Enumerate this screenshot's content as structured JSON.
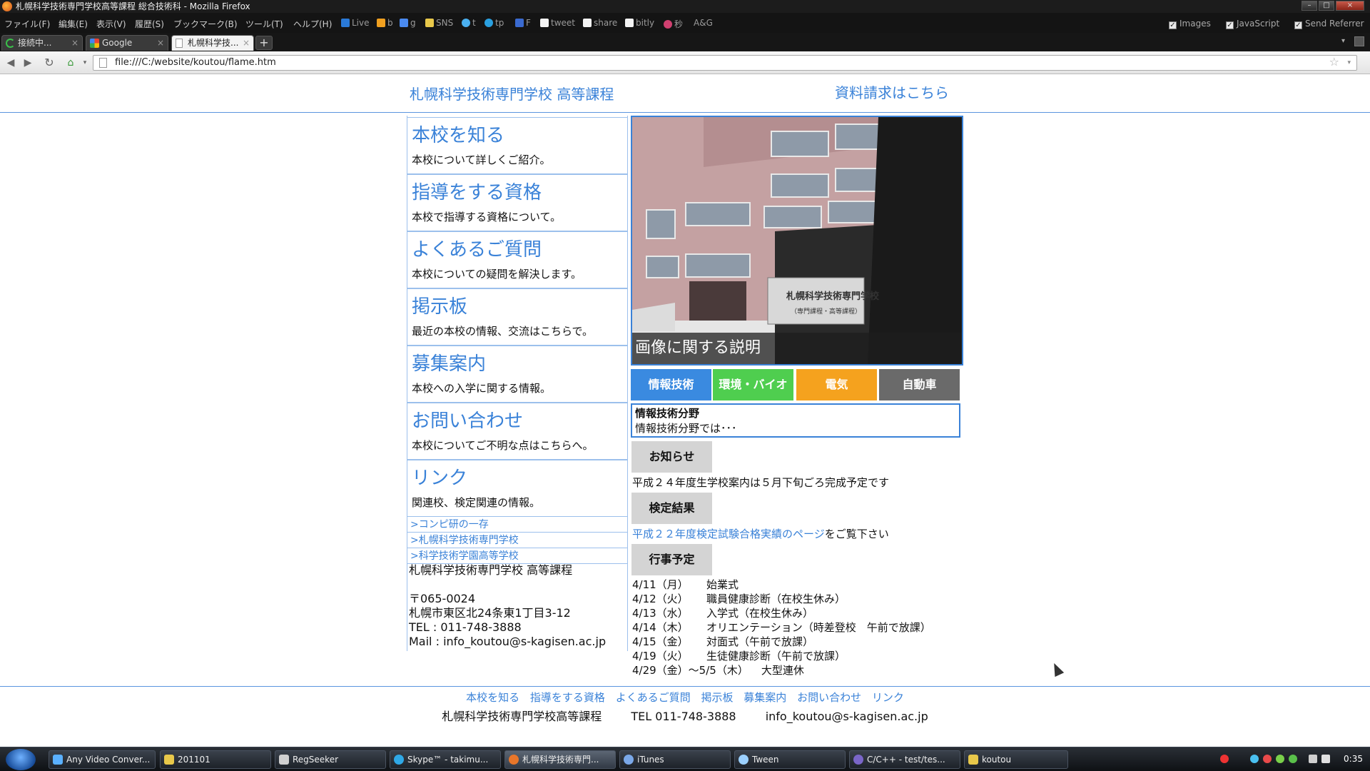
{
  "window": {
    "title": "札幌科学技術専門学校高等課程 総合技術科 - Mozilla Firefox",
    "controls": [
      "–",
      "□",
      "×"
    ]
  },
  "menubar": {
    "menus": [
      "ファイル(F)",
      "編集(E)",
      "表示(V)",
      "履歴(S)",
      "ブックマーク(B)",
      "ツール(T)",
      "ヘルプ(H)"
    ],
    "bookmarks": [
      "Live",
      "b",
      "g",
      "SNS",
      "t",
      "tp",
      "F",
      "tweet",
      "share",
      "bitly",
      "秒",
      "A&G"
    ],
    "toggles": [
      "Images",
      "JavaScript",
      "Send Referrer"
    ]
  },
  "tabs": [
    {
      "label": "接続中...",
      "active": false
    },
    {
      "label": "Google",
      "active": false
    },
    {
      "label": "札幌科学技...",
      "active": true
    }
  ],
  "navbar": {
    "url": "file:///C:/website/koutou/flame.htm"
  },
  "page": {
    "site_title": "札幌科学技術専門学校 高等課程",
    "request_link": "資料請求はこちら",
    "menu": [
      {
        "title": "本校を知る",
        "desc": "本校について詳しくご紹介。"
      },
      {
        "title": "指導をする資格",
        "desc": "本校で指導する資格について。"
      },
      {
        "title": "よくあるご質問",
        "desc": "本校についての疑問を解決します。"
      },
      {
        "title": "掲示板",
        "desc": "最近の本校の情報、交流はこちらで。"
      },
      {
        "title": "募集案内",
        "desc": "本校への入学に関する情報。"
      },
      {
        "title": "お問い合わせ",
        "desc": "本校についてご不明な点はこちらへ。"
      },
      {
        "title": "リンク",
        "desc": "関連校、検定関連の情報。"
      }
    ],
    "sublinks": [
      ">コンピ研の一存",
      ">札幌科学技術専門学校",
      ">科学技術学園高等学校"
    ],
    "address": {
      "name": "札幌科学技術専門学校 高等課程",
      "zip": "〒065-0024",
      "street": "札幌市東区北24条東1丁目3-12",
      "tel": "TEL : 011-748-3888",
      "mail": "Mail : info_koutou@s-kagisen.ac.jp"
    },
    "photo_caption": "画像に関する説明",
    "photo_sign": "札幌科学技術専門学校",
    "photo_sign_sub": "（専門課程・高等課程）",
    "dept_tabs": [
      {
        "label": "情報技術",
        "color": "#3a8ae0"
      },
      {
        "label": "環境・バイオ",
        "color": "#4fce4f"
      },
      {
        "label": "電気",
        "color": "#f5a21e"
      },
      {
        "label": "自動車",
        "color": "#6a6a6a"
      }
    ],
    "info_box": {
      "title": "情報技術分野",
      "text": "情報技術分野では･･･"
    },
    "sections": {
      "notice": {
        "label": "お知らせ",
        "text": "平成２４年度生学校案内は５月下旬ごろ完成予定です"
      },
      "exam": {
        "label": "検定結果",
        "link": "平成２２年度検定試験合格実績のページ",
        "suffix": "をご覧下さい"
      },
      "events": {
        "label": "行事予定"
      }
    },
    "events": [
      {
        "date": "4/11（月）",
        "text": "始業式"
      },
      {
        "date": "4/12（火）",
        "text": "職員健康診断（在校生休み）"
      },
      {
        "date": "4/13（水）",
        "text": "入学式（在校生休み）"
      },
      {
        "date": "4/14（木）",
        "text": "オリエンテーション（時差登校　午前で放課）"
      },
      {
        "date": "4/15（金）",
        "text": "対面式（午前で放課）"
      },
      {
        "date": "4/19（火）",
        "text": "生徒健康診断（午前で放課）"
      },
      {
        "date": "4/29（金）～5/5（木）",
        "text": "大型連休"
      }
    ],
    "footer_links": [
      "本校を知る",
      "指導をする資格",
      "よくあるご質問",
      "掲示板",
      "募集案内",
      "お問い合わせ",
      "リンク"
    ],
    "footer_info": [
      "札幌科学技術専門学校高等課程",
      "TEL 011-748-3888",
      "info_koutou@s-kagisen.ac.jp"
    ]
  },
  "taskbar": {
    "items": [
      {
        "label": "Any Video Conver...",
        "color": "#5ab0ff"
      },
      {
        "label": "201101",
        "color": "#e8c84a"
      },
      {
        "label": "RegSeeker",
        "color": "#d0d0d0"
      },
      {
        "label": "Skype™ - takimu...",
        "color": "#2fa8e6"
      },
      {
        "label": "札幌科学技術専門...",
        "color": "#e8762a"
      },
      {
        "label": "iTunes",
        "color": "#7aa8e8"
      },
      {
        "label": "Tween",
        "color": "#9bd0ff"
      },
      {
        "label": "C/C++ - test/tes...",
        "color": "#7a66c8"
      },
      {
        "label": "koutou",
        "color": "#e8c84a"
      }
    ],
    "clock": "0:35"
  }
}
